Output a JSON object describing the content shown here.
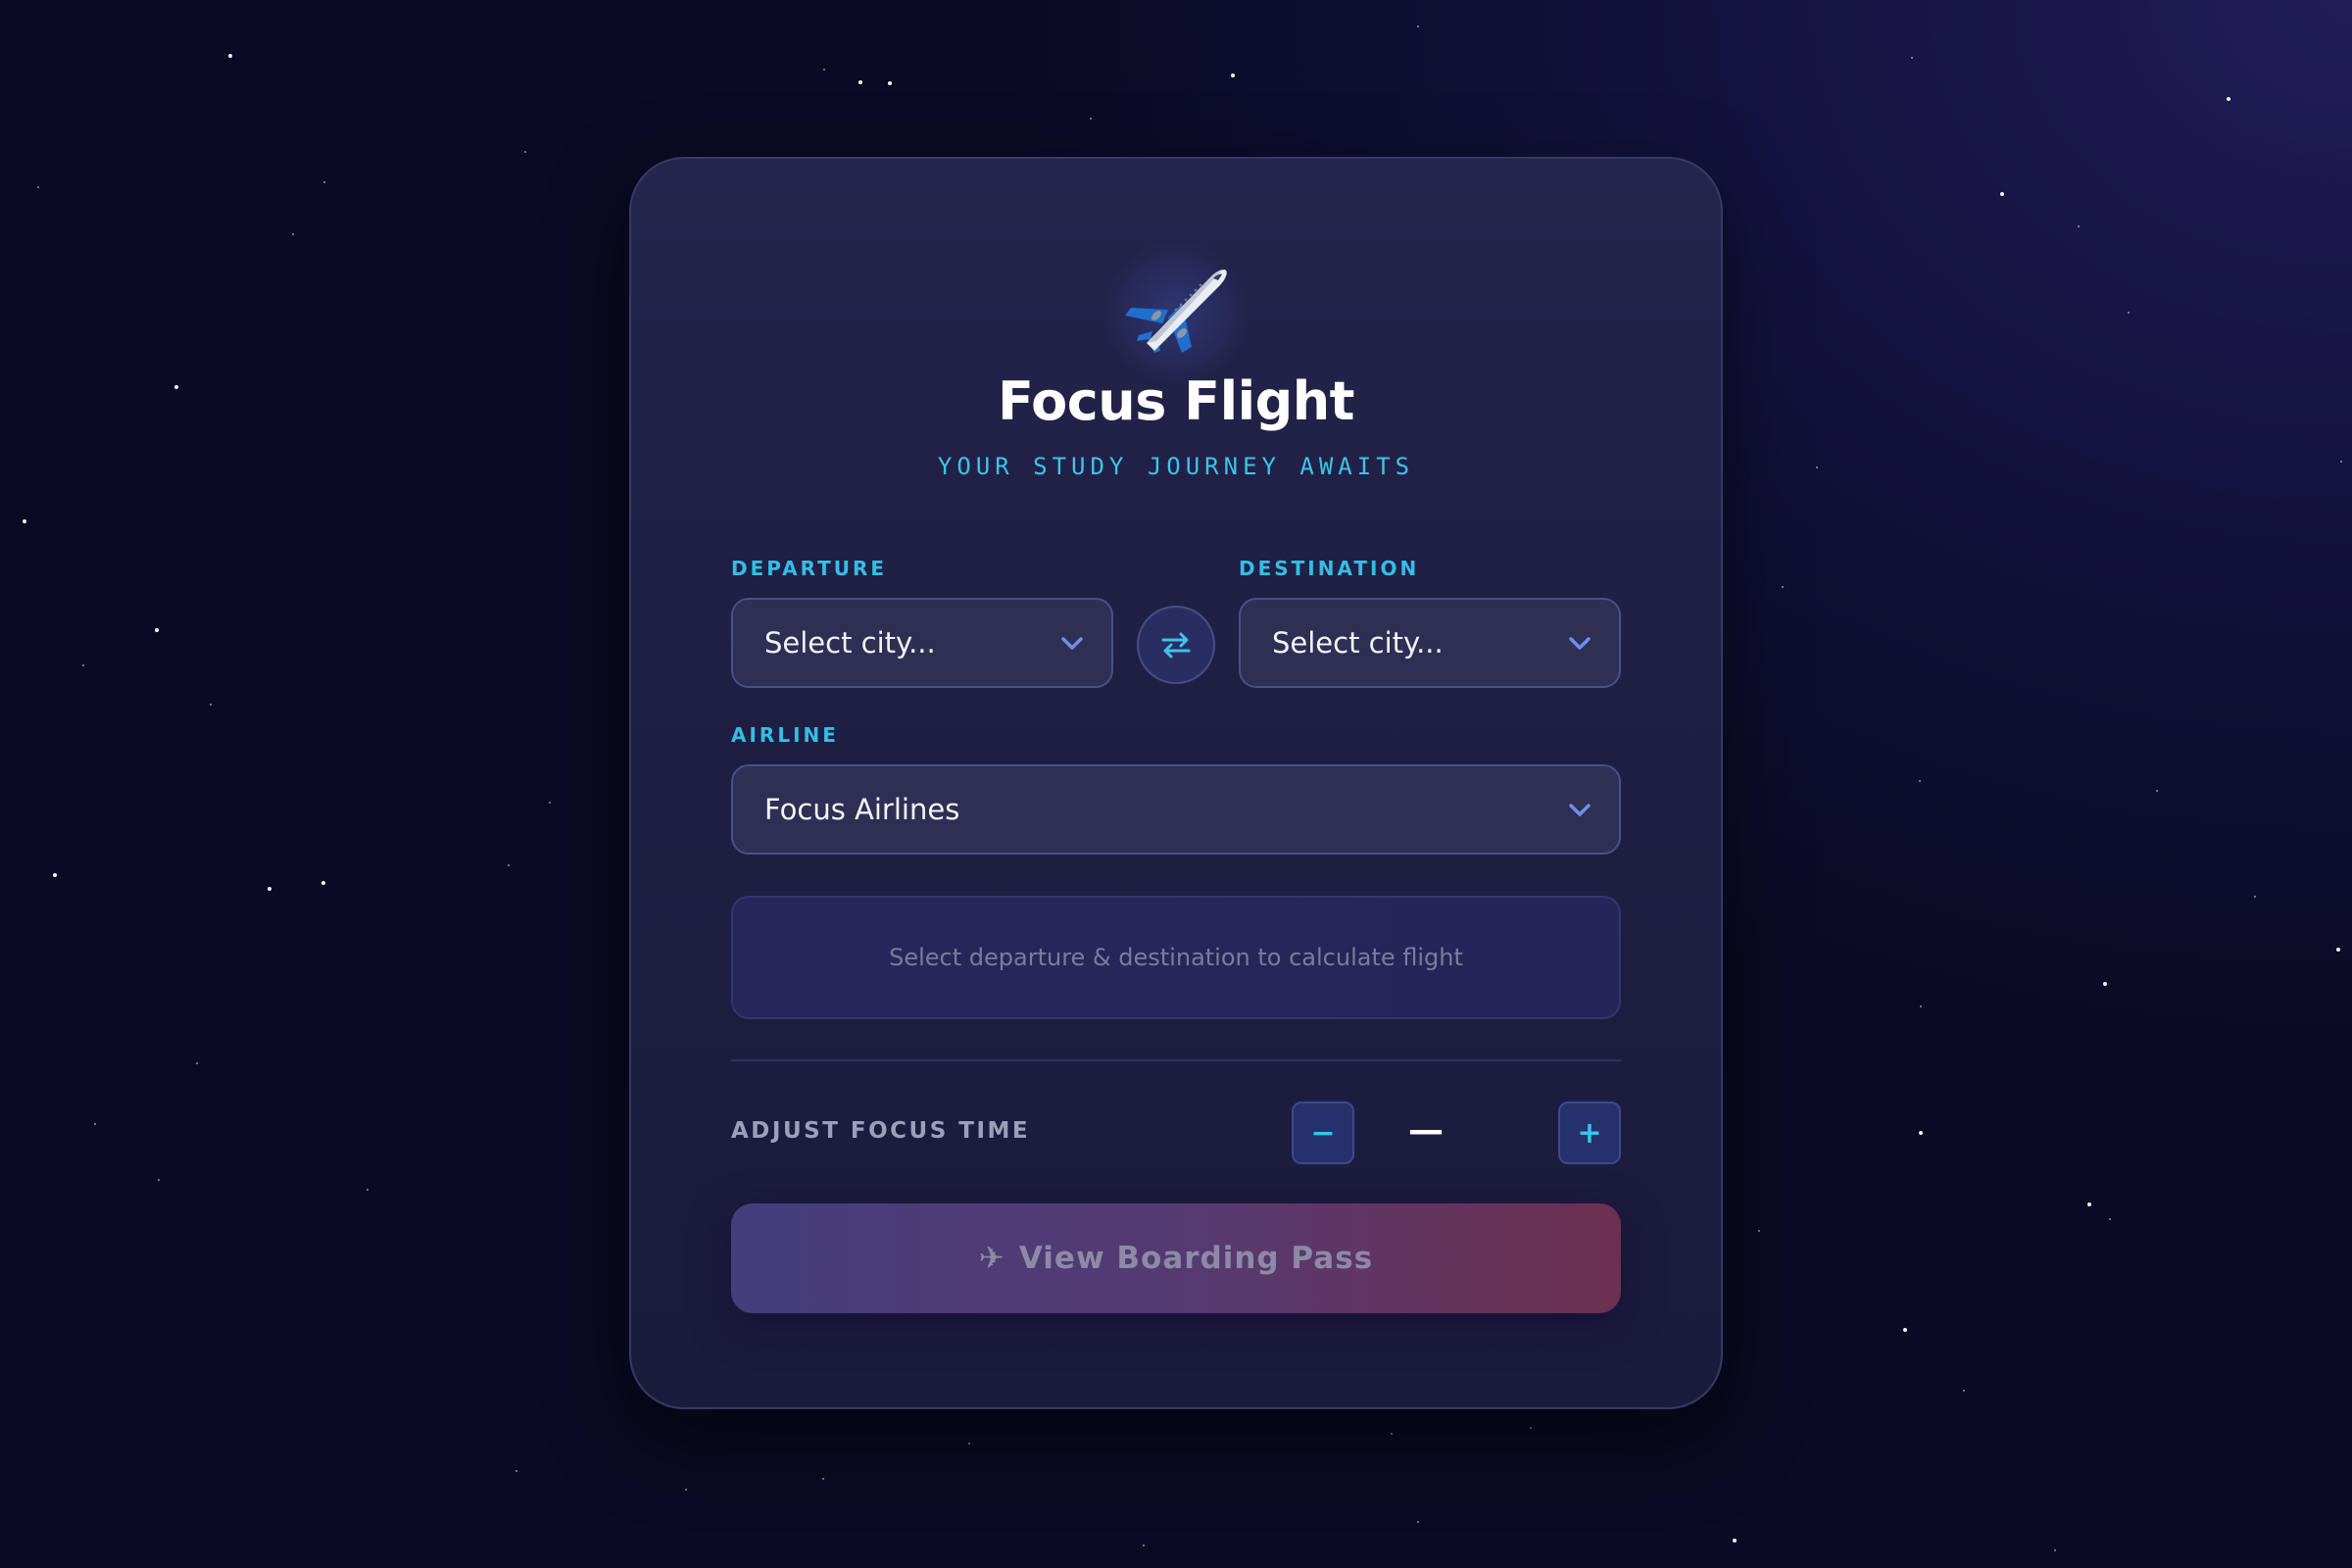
{
  "app": {
    "title": "Focus Flight",
    "subtitle": "YOUR STUDY JOURNEY AWAITS",
    "logo_icon": "airplane-icon"
  },
  "form": {
    "departure": {
      "label": "DEPARTURE",
      "value": "Select city..."
    },
    "destination": {
      "label": "DESTINATION",
      "value": "Select city..."
    },
    "swap_icon": "swap-arrows-icon",
    "airline": {
      "label": "AIRLINE",
      "value": "Focus Airlines"
    }
  },
  "flight_info": {
    "placeholder": "Select departure & destination to calculate flight"
  },
  "focus_time": {
    "label": "ADJUST FOCUS TIME",
    "decrement_label": "−",
    "increment_label": "+",
    "value": "—"
  },
  "cta": {
    "icon": "✈",
    "label": "View Boarding Pass"
  },
  "colors": {
    "accent": "#3ec3e8",
    "chevron": "#6f8cf0",
    "background": "#0f0f33",
    "card": "#1e1e42"
  }
}
